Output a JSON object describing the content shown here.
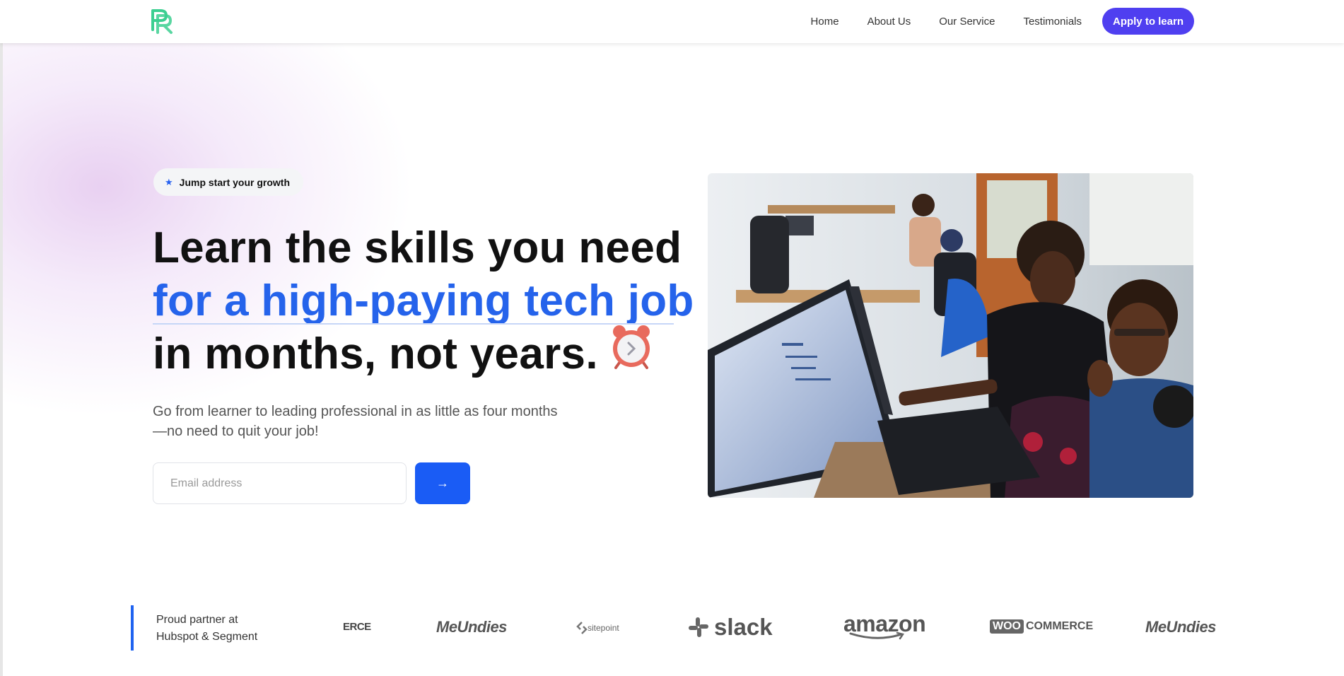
{
  "brand": {
    "logo_icon": "pr-logo-icon",
    "accent_color": "#4f3ff0",
    "primary_blue": "#2563eb"
  },
  "nav": {
    "links": [
      "Home",
      "About Us",
      "Our Service",
      "Testimonials"
    ],
    "cta_label": "Apply to learn"
  },
  "hero": {
    "badge": "Jump start your growth",
    "badge_icon": "star-icon",
    "headline_line1": "Learn the skills you need",
    "headline_line2": "for a high-paying tech job",
    "headline_line3": "in months, not years.",
    "headline_emoji": "alarm-clock-icon",
    "subtext_line1": "Go from learner to leading professional in as little as four months",
    "subtext_line2": "—no need to quit your job!",
    "email_placeholder": "Email address",
    "submit_label": "→",
    "image_alt": "People working on laptops in an office"
  },
  "partners": {
    "label_line1": "Proud partner at",
    "label_line2": "Hubspot & Segment",
    "logos": [
      "ERCE",
      "MeUndies",
      "sitepoint",
      "slack",
      "amazon",
      "WOO",
      "COMMERCE",
      "MeUndies"
    ]
  }
}
